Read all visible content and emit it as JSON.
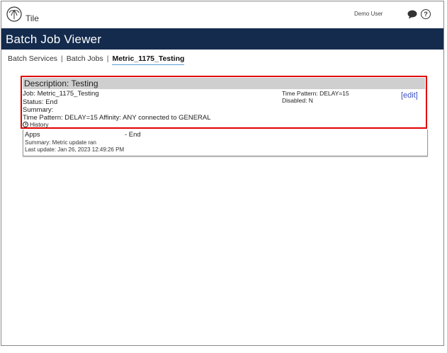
{
  "app": {
    "name": "Tile",
    "user": "Demo User"
  },
  "page": {
    "title": "Batch Job Viewer"
  },
  "breadcrumb": {
    "items": [
      "Batch Services",
      "Batch Jobs"
    ],
    "current": "Metric_1175_Testing"
  },
  "job": {
    "header": "Description: Testing",
    "job_line": "Job: Metric_1175_Testing",
    "status_line": "Status: End",
    "summary_line": "Summary:",
    "time_affinity_line": "Time Pattern: DELAY=15 Affinity: ANY connected to GENERAL",
    "time_pattern_right": "Time Pattern: DELAY=15",
    "disabled_right": "Disabled: N",
    "edit_label": "[edit]",
    "history_label": "History"
  },
  "apps": {
    "name": "Apps",
    "status": "- End",
    "summary": "Summary: Metric update ran",
    "last_update": "Last update: Jan 26, 2023 12:49:26 PM"
  },
  "icons": {
    "logo": "palm-logo-icon",
    "chat": "chat-icon",
    "help": "help-icon",
    "history": "clock-icon"
  },
  "colors": {
    "title_bar": "#142b4d",
    "highlight_border": "#e00000",
    "edit_link": "#3a4fbf",
    "card_header": "#cfcfcf"
  }
}
